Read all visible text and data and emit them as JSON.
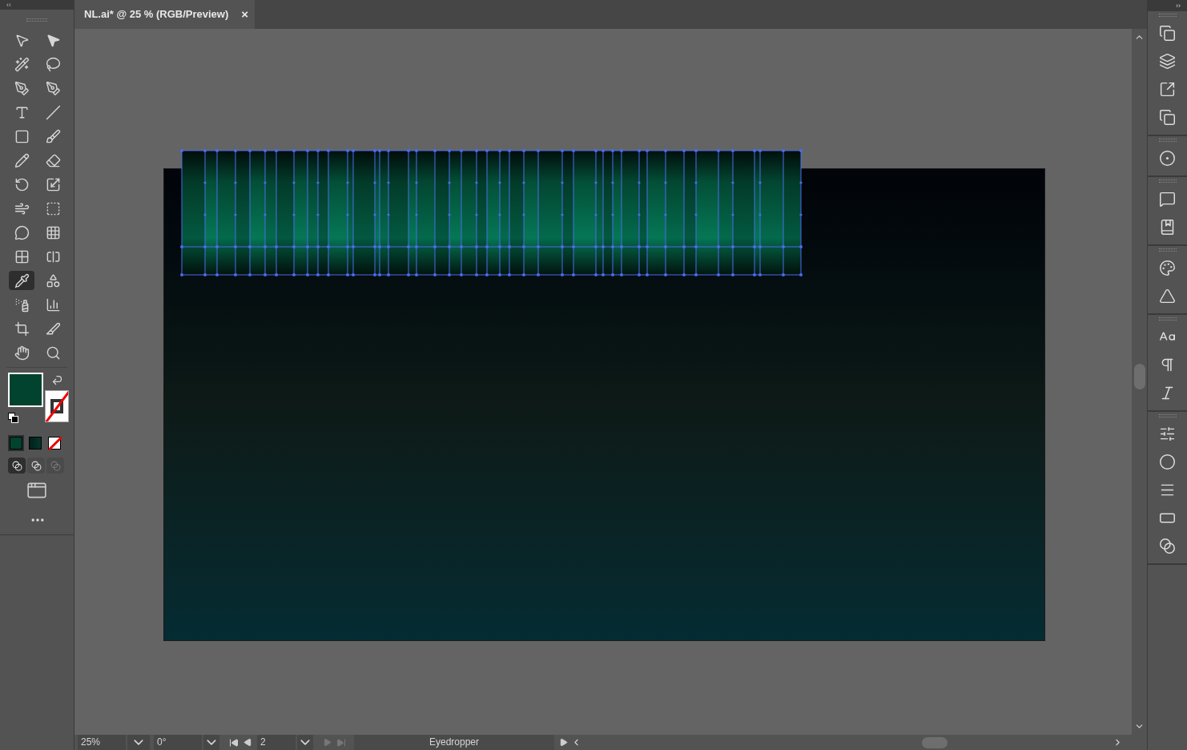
{
  "left_collapse": "‹‹",
  "right_collapse": "››",
  "document_tab": {
    "title": "NL.ai* @ 25 % (RGB/Preview)",
    "close": "×"
  },
  "tools": [
    {
      "selected": false
    },
    {
      "selected": false
    },
    {
      "selected": false
    },
    {
      "selected": false
    },
    {
      "selected": false
    },
    {
      "selected": false
    },
    {
      "selected": false
    },
    {
      "selected": false
    },
    {
      "selected": false
    },
    {
      "selected": false
    },
    {
      "selected": false
    },
    {
      "selected": false
    },
    {
      "selected": false
    },
    {
      "selected": false
    },
    {
      "selected": false
    },
    {
      "selected": false
    },
    {
      "selected": false
    },
    {
      "selected": false
    },
    {
      "selected": false
    },
    {
      "selected": false
    },
    {
      "selected": true
    },
    {
      "selected": false
    },
    {
      "selected": false
    },
    {
      "selected": false
    },
    {
      "selected": false
    },
    {
      "selected": false
    },
    {
      "selected": false
    },
    {
      "selected": false
    }
  ],
  "draw_modes": [
    {
      "selected": true
    },
    {
      "selected": false
    },
    {
      "selected": false
    }
  ],
  "status_bar": {
    "zoom": "25%",
    "rotation": "0°",
    "artboard": "2",
    "current_tool": "Eyedropper"
  }
}
